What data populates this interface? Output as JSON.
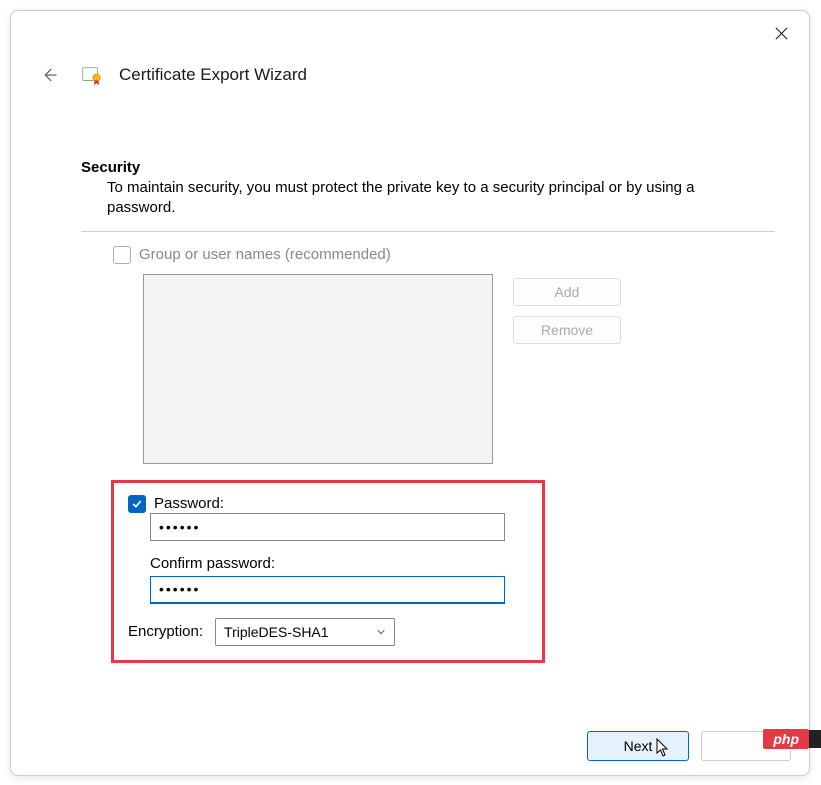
{
  "window": {
    "title": "Certificate Export Wizard"
  },
  "section": {
    "heading": "Security",
    "description": "To maintain security, you must protect the private key to a security principal or by using a password."
  },
  "group": {
    "checkbox_label": "Group or user names (recommended)",
    "add_label": "Add",
    "remove_label": "Remove"
  },
  "password": {
    "checkbox_label": "Password:",
    "value": "••••••",
    "confirm_label": "Confirm password:",
    "confirm_value": "••••••"
  },
  "encryption": {
    "label": "Encryption:",
    "selected": "TripleDES-SHA1"
  },
  "footer": {
    "next": "Next"
  },
  "badge": {
    "php": "php"
  }
}
